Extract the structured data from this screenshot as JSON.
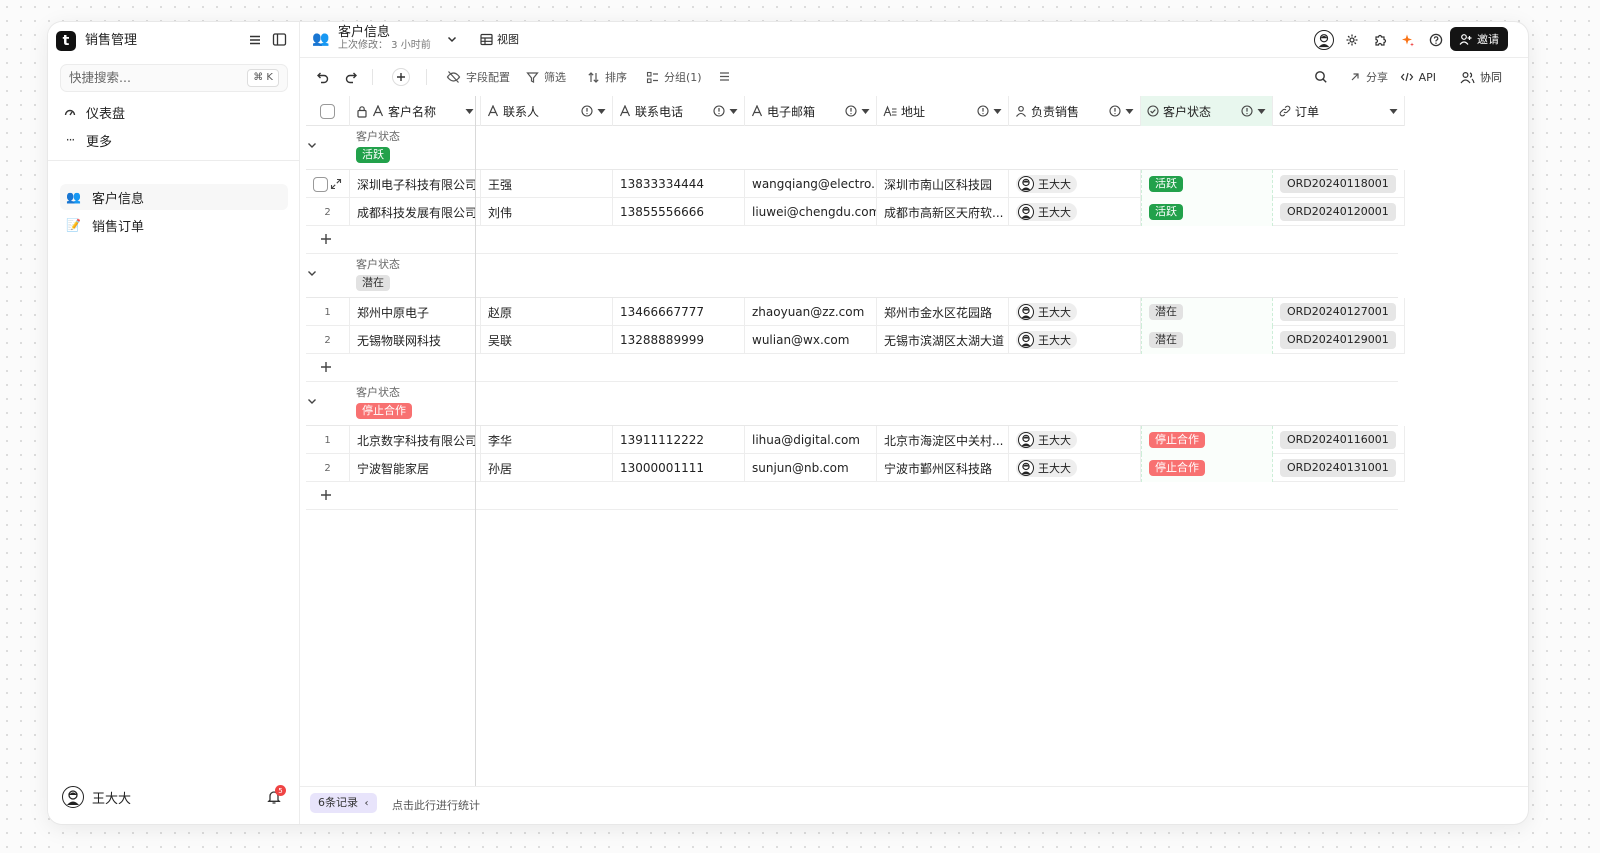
{
  "app": {
    "title": "销售管理",
    "search_placeholder": "快捷搜索...",
    "search_shortcut": "⌘ K"
  },
  "sidebar": {
    "nav": [
      {
        "label": "仪表盘",
        "icon": "dashboard-icon"
      },
      {
        "label": "更多",
        "icon": "more-icon"
      }
    ],
    "tables": [
      {
        "label": "客户信息",
        "emoji": "👥",
        "active": true
      },
      {
        "label": "销售订单",
        "emoji": "📝",
        "active": false
      }
    ],
    "user": {
      "name": "王大大",
      "notifications": "5"
    }
  },
  "header": {
    "table_name": "客户信息",
    "last_modified": "上次修改： 3 小时前",
    "view_label": "视图",
    "invite_label": "邀请"
  },
  "toolbar": {
    "field_config": "字段配置",
    "filter": "筛选",
    "sort": "排序",
    "group": "分组(1)",
    "share": "分享",
    "api": "API",
    "collaborate": "协同"
  },
  "columns": [
    {
      "label": "客户名称",
      "icon": "text-icon"
    },
    {
      "label": "联系人",
      "icon": "text-icon"
    },
    {
      "label": "联系电话",
      "icon": "text-icon"
    },
    {
      "label": "电子邮箱",
      "icon": "text-icon"
    },
    {
      "label": "地址",
      "icon": "long-text-icon"
    },
    {
      "label": "负责销售",
      "icon": "user-icon"
    },
    {
      "label": "客户状态",
      "icon": "status-icon"
    },
    {
      "label": "订单",
      "icon": "link-icon"
    }
  ],
  "groups": [
    {
      "field": "客户状态",
      "value": "活跃",
      "tag_bg": "#22a14b",
      "tag_fg": "#ffffff",
      "rows": [
        {
          "num": "",
          "name": "深圳电子科技有限公司",
          "contact": "王强",
          "phone": "13833334444",
          "email": "wangqiang@electro...",
          "address": "深圳市南山区科技园",
          "sales": "王大大",
          "status": "活跃",
          "order": "ORD20240118001"
        },
        {
          "num": "2",
          "name": "成都科技发展有限公司",
          "contact": "刘伟",
          "phone": "13855556666",
          "email": "liuwei@chengdu.com",
          "address": "成都市高新区天府软...",
          "sales": "王大大",
          "status": "活跃",
          "order": "ORD20240120001"
        }
      ]
    },
    {
      "field": "客户状态",
      "value": "潜在",
      "tag_bg": "#e2e2e2",
      "tag_fg": "#333333",
      "rows": [
        {
          "num": "1",
          "name": "郑州中原电子",
          "contact": "赵原",
          "phone": "13466667777",
          "email": "zhaoyuan@zz.com",
          "address": "郑州市金水区花园路",
          "sales": "王大大",
          "status": "潜在",
          "order": "ORD20240127001"
        },
        {
          "num": "2",
          "name": "无锡物联网科技",
          "contact": "吴联",
          "phone": "13288889999",
          "email": "wulian@wx.com",
          "address": "无锡市滨湖区太湖大道",
          "sales": "王大大",
          "status": "潜在",
          "order": "ORD20240129001"
        }
      ]
    },
    {
      "field": "客户状态",
      "value": "停止合作",
      "tag_bg": "#f87171",
      "tag_fg": "#ffffff",
      "rows": [
        {
          "num": "1",
          "name": "北京数字科技有限公司",
          "contact": "李华",
          "phone": "13911112222",
          "email": "lihua@digital.com",
          "address": "北京市海淀区中关村...",
          "sales": "王大大",
          "status": "停止合作",
          "order": "ORD20240116001"
        },
        {
          "num": "2",
          "name": "宁波智能家居",
          "contact": "孙居",
          "phone": "13000001111",
          "email": "sunjun@nb.com",
          "address": "宁波市鄞州区科技路",
          "sales": "王大大",
          "status": "停止合作",
          "order": "ORD20240131001"
        }
      ]
    }
  ],
  "footer": {
    "records": "6条记录",
    "stats_hint": "点击此行进行统计"
  }
}
